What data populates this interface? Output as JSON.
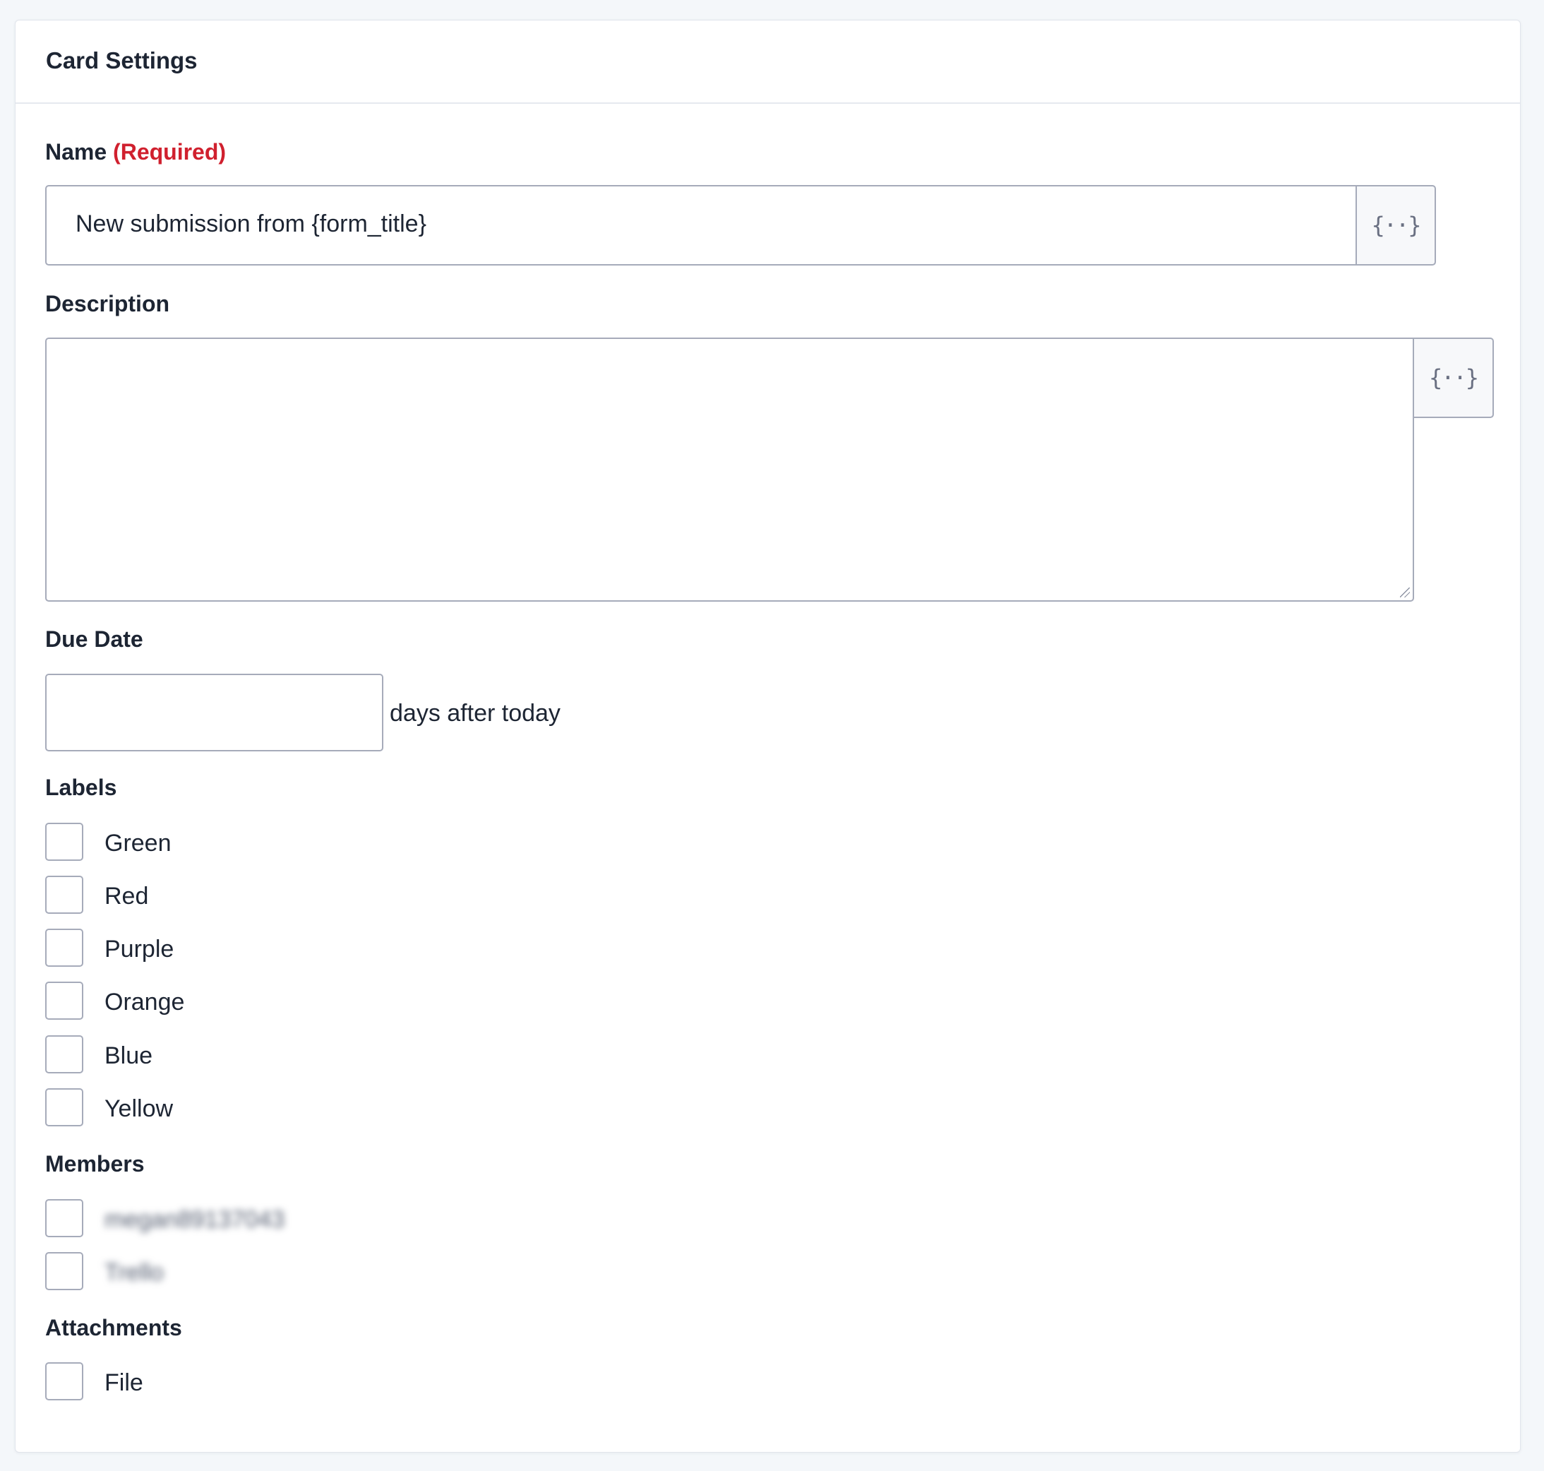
{
  "card": {
    "title": "Card Settings"
  },
  "name_field": {
    "label": "Name",
    "required_text": "(Required)",
    "value": "New submission from {form_title}",
    "merge_tag_icon": "merge-tags-icon"
  },
  "description_field": {
    "label": "Description",
    "value": "",
    "merge_tag_icon": "merge-tags-icon"
  },
  "due_date_field": {
    "label": "Due Date",
    "value": "",
    "suffix": "days after today"
  },
  "labels_field": {
    "label": "Labels",
    "options": [
      {
        "label": "Green",
        "checked": false
      },
      {
        "label": "Red",
        "checked": false
      },
      {
        "label": "Purple",
        "checked": false
      },
      {
        "label": "Orange",
        "checked": false
      },
      {
        "label": "Blue",
        "checked": false
      },
      {
        "label": "Yellow",
        "checked": false
      }
    ]
  },
  "members_field": {
    "label": "Members",
    "options": [
      {
        "label": "megan89137043",
        "checked": false,
        "blurred": true
      },
      {
        "label": "Trello",
        "checked": false,
        "blurred": true
      }
    ]
  },
  "attachments_field": {
    "label": "Attachments",
    "options": [
      {
        "label": "File",
        "checked": false
      }
    ]
  },
  "colors": {
    "required": "#d0202e",
    "text": "#1d2533",
    "border": "#a6abba",
    "background": "#f4f7fa"
  }
}
